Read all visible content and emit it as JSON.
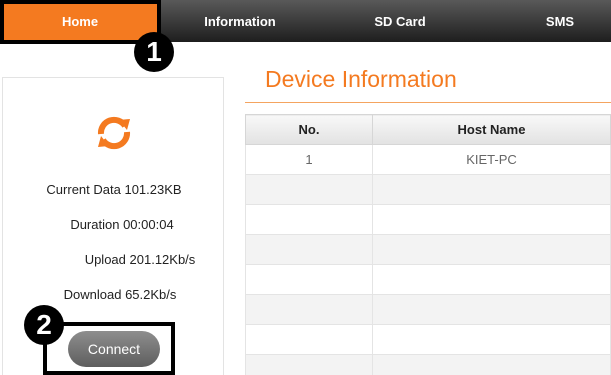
{
  "nav": {
    "tabs": [
      {
        "label": "Home",
        "active": true
      },
      {
        "label": "Information",
        "active": false
      },
      {
        "label": "SD Card",
        "active": false
      },
      {
        "label": "SMS",
        "active": false
      }
    ]
  },
  "annotations": {
    "marker_1": "1",
    "marker_2": "2"
  },
  "status_panel": {
    "icon": "sync-icon",
    "current_data": {
      "label": "Current Data",
      "value": "101.23KB"
    },
    "duration": {
      "label": "Duration",
      "value": "00:00:04"
    },
    "upload": {
      "label": "Upload",
      "value": "201.12Kb/s"
    },
    "download": {
      "label": "Download",
      "value": "65.2Kb/s"
    },
    "connect_label": "Connect"
  },
  "device_info": {
    "title": "Device Information",
    "columns": [
      "No.",
      "Host Name"
    ],
    "rows": [
      {
        "no": "1",
        "host": "KIET-PC"
      },
      {
        "no": "",
        "host": ""
      },
      {
        "no": "",
        "host": ""
      },
      {
        "no": "",
        "host": ""
      },
      {
        "no": "",
        "host": ""
      },
      {
        "no": "",
        "host": ""
      },
      {
        "no": "",
        "host": ""
      },
      {
        "no": "",
        "host": ""
      }
    ]
  },
  "colors": {
    "accent": "#f47a20",
    "nav_bg": "#2a2a2a",
    "button_bg": "#777777"
  }
}
